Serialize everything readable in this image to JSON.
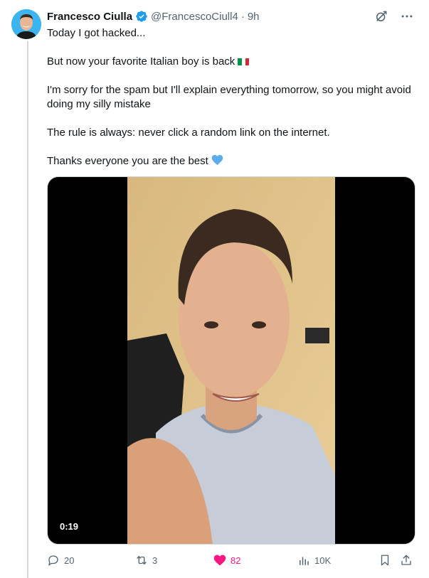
{
  "tweet": {
    "author_name": "Francesco Ciulla",
    "handle": "@FrancescoCiull4",
    "separator": "·",
    "time": "9h",
    "lines": [
      "Today I got hacked...",
      "But now your favorite Italian boy is back",
      "I'm sorry for the spam but I'll explain everything tomorrow, so you might avoid doing my silly mistake",
      "The rule is always: never click a random link on the internet.",
      "Thanks everyone you are the best"
    ],
    "video_duration": "0:19"
  },
  "icons": {
    "verified": "verified-badge-icon",
    "grok": "grok-icon",
    "more": "more-icon",
    "flag": "italy-flag-emoji",
    "heart": "blue-heart-emoji"
  },
  "actions": {
    "replies": "20",
    "reposts": "3",
    "likes": "82",
    "views": "10K"
  },
  "colors": {
    "accent": "#1d9bf0",
    "like": "#f91880",
    "secondary_text": "#536471"
  }
}
